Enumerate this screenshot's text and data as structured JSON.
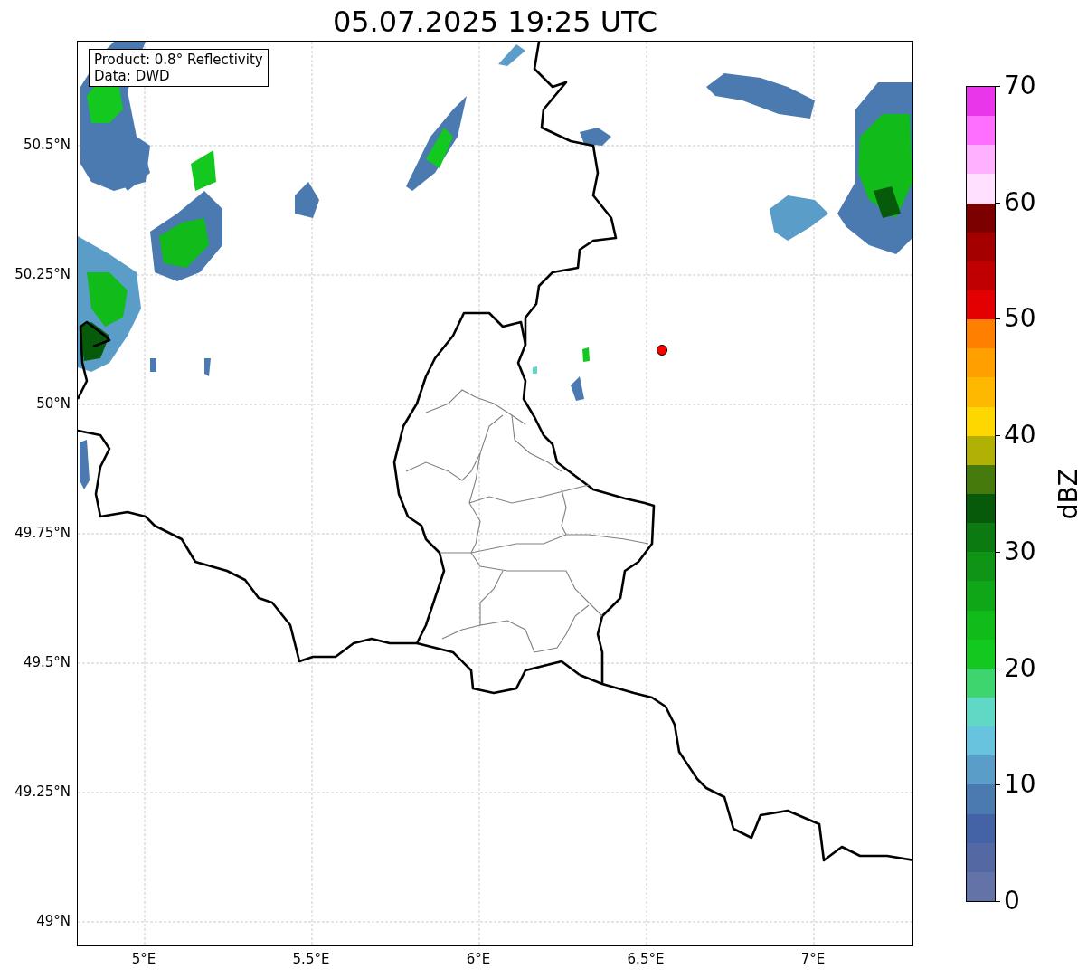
{
  "title": "05.07.2025 19:25 UTC",
  "info_box": {
    "lines": [
      "Product: 0.8° Reflectivity",
      "Data: DWD"
    ]
  },
  "map": {
    "lat_ticks": [
      "50.5°N",
      "50.25°N",
      "50°N",
      "49.75°N",
      "49.5°N",
      "49.25°N",
      "49°N"
    ],
    "lon_ticks": [
      "5°E",
      "5.5°E",
      "6°E",
      "6.5°E",
      "7°E"
    ],
    "marker": {
      "color": "#ff0000"
    }
  },
  "colorbar": {
    "label": "dBZ",
    "ticks": [
      "70",
      "60",
      "50",
      "40",
      "30",
      "20",
      "10",
      "0"
    ],
    "segments": [
      {
        "color": "#ea36ea"
      },
      {
        "color": "#ff6fff"
      },
      {
        "color": "#ffb0ff"
      },
      {
        "color": "#ffe0ff"
      },
      {
        "color": "#7d0000"
      },
      {
        "color": "#a40000"
      },
      {
        "color": "#c00000"
      },
      {
        "color": "#e40000"
      },
      {
        "color": "#ff8000"
      },
      {
        "color": "#ff9f00"
      },
      {
        "color": "#ffb800"
      },
      {
        "color": "#ffd700"
      },
      {
        "color": "#b1b005"
      },
      {
        "color": "#477a0c"
      },
      {
        "color": "#075a0a"
      },
      {
        "color": "#0b7a10"
      },
      {
        "color": "#0f9416"
      },
      {
        "color": "#0fa617"
      },
      {
        "color": "#10bb1a"
      },
      {
        "color": "#13c81e"
      },
      {
        "color": "#3ed46e"
      },
      {
        "color": "#60d8c6"
      },
      {
        "color": "#67c3de"
      },
      {
        "color": "#5a9dc8"
      },
      {
        "color": "#4b7ab0"
      },
      {
        "color": "#4462a6"
      },
      {
        "color": "#5468a4"
      },
      {
        "color": "#6373a8"
      }
    ]
  }
}
